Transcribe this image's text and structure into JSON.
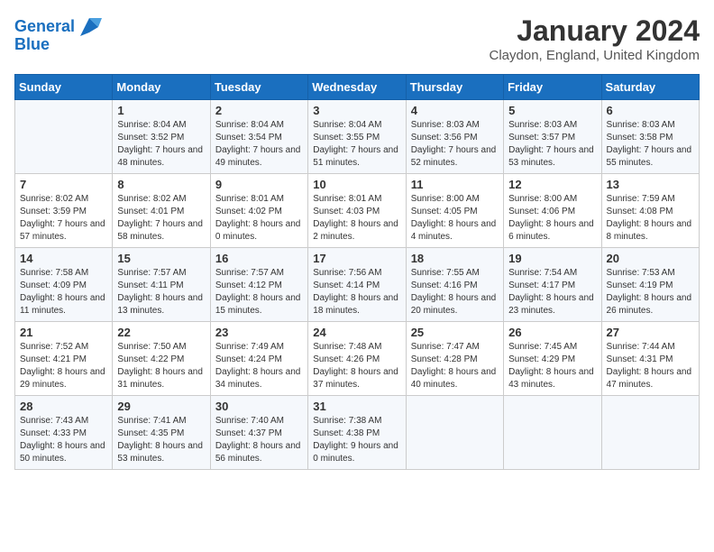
{
  "header": {
    "logo_line1": "General",
    "logo_line2": "Blue",
    "month": "January 2024",
    "location": "Claydon, England, United Kingdom"
  },
  "weekdays": [
    "Sunday",
    "Monday",
    "Tuesday",
    "Wednesday",
    "Thursday",
    "Friday",
    "Saturday"
  ],
  "weeks": [
    [
      {
        "day": "",
        "sunrise": "",
        "sunset": "",
        "daylight": ""
      },
      {
        "day": "1",
        "sunrise": "Sunrise: 8:04 AM",
        "sunset": "Sunset: 3:52 PM",
        "daylight": "Daylight: 7 hours and 48 minutes."
      },
      {
        "day": "2",
        "sunrise": "Sunrise: 8:04 AM",
        "sunset": "Sunset: 3:54 PM",
        "daylight": "Daylight: 7 hours and 49 minutes."
      },
      {
        "day": "3",
        "sunrise": "Sunrise: 8:04 AM",
        "sunset": "Sunset: 3:55 PM",
        "daylight": "Daylight: 7 hours and 51 minutes."
      },
      {
        "day": "4",
        "sunrise": "Sunrise: 8:03 AM",
        "sunset": "Sunset: 3:56 PM",
        "daylight": "Daylight: 7 hours and 52 minutes."
      },
      {
        "day": "5",
        "sunrise": "Sunrise: 8:03 AM",
        "sunset": "Sunset: 3:57 PM",
        "daylight": "Daylight: 7 hours and 53 minutes."
      },
      {
        "day": "6",
        "sunrise": "Sunrise: 8:03 AM",
        "sunset": "Sunset: 3:58 PM",
        "daylight": "Daylight: 7 hours and 55 minutes."
      }
    ],
    [
      {
        "day": "7",
        "sunrise": "Sunrise: 8:02 AM",
        "sunset": "Sunset: 3:59 PM",
        "daylight": "Daylight: 7 hours and 57 minutes."
      },
      {
        "day": "8",
        "sunrise": "Sunrise: 8:02 AM",
        "sunset": "Sunset: 4:01 PM",
        "daylight": "Daylight: 7 hours and 58 minutes."
      },
      {
        "day": "9",
        "sunrise": "Sunrise: 8:01 AM",
        "sunset": "Sunset: 4:02 PM",
        "daylight": "Daylight: 8 hours and 0 minutes."
      },
      {
        "day": "10",
        "sunrise": "Sunrise: 8:01 AM",
        "sunset": "Sunset: 4:03 PM",
        "daylight": "Daylight: 8 hours and 2 minutes."
      },
      {
        "day": "11",
        "sunrise": "Sunrise: 8:00 AM",
        "sunset": "Sunset: 4:05 PM",
        "daylight": "Daylight: 8 hours and 4 minutes."
      },
      {
        "day": "12",
        "sunrise": "Sunrise: 8:00 AM",
        "sunset": "Sunset: 4:06 PM",
        "daylight": "Daylight: 8 hours and 6 minutes."
      },
      {
        "day": "13",
        "sunrise": "Sunrise: 7:59 AM",
        "sunset": "Sunset: 4:08 PM",
        "daylight": "Daylight: 8 hours and 8 minutes."
      }
    ],
    [
      {
        "day": "14",
        "sunrise": "Sunrise: 7:58 AM",
        "sunset": "Sunset: 4:09 PM",
        "daylight": "Daylight: 8 hours and 11 minutes."
      },
      {
        "day": "15",
        "sunrise": "Sunrise: 7:57 AM",
        "sunset": "Sunset: 4:11 PM",
        "daylight": "Daylight: 8 hours and 13 minutes."
      },
      {
        "day": "16",
        "sunrise": "Sunrise: 7:57 AM",
        "sunset": "Sunset: 4:12 PM",
        "daylight": "Daylight: 8 hours and 15 minutes."
      },
      {
        "day": "17",
        "sunrise": "Sunrise: 7:56 AM",
        "sunset": "Sunset: 4:14 PM",
        "daylight": "Daylight: 8 hours and 18 minutes."
      },
      {
        "day": "18",
        "sunrise": "Sunrise: 7:55 AM",
        "sunset": "Sunset: 4:16 PM",
        "daylight": "Daylight: 8 hours and 20 minutes."
      },
      {
        "day": "19",
        "sunrise": "Sunrise: 7:54 AM",
        "sunset": "Sunset: 4:17 PM",
        "daylight": "Daylight: 8 hours and 23 minutes."
      },
      {
        "day": "20",
        "sunrise": "Sunrise: 7:53 AM",
        "sunset": "Sunset: 4:19 PM",
        "daylight": "Daylight: 8 hours and 26 minutes."
      }
    ],
    [
      {
        "day": "21",
        "sunrise": "Sunrise: 7:52 AM",
        "sunset": "Sunset: 4:21 PM",
        "daylight": "Daylight: 8 hours and 29 minutes."
      },
      {
        "day": "22",
        "sunrise": "Sunrise: 7:50 AM",
        "sunset": "Sunset: 4:22 PM",
        "daylight": "Daylight: 8 hours and 31 minutes."
      },
      {
        "day": "23",
        "sunrise": "Sunrise: 7:49 AM",
        "sunset": "Sunset: 4:24 PM",
        "daylight": "Daylight: 8 hours and 34 minutes."
      },
      {
        "day": "24",
        "sunrise": "Sunrise: 7:48 AM",
        "sunset": "Sunset: 4:26 PM",
        "daylight": "Daylight: 8 hours and 37 minutes."
      },
      {
        "day": "25",
        "sunrise": "Sunrise: 7:47 AM",
        "sunset": "Sunset: 4:28 PM",
        "daylight": "Daylight: 8 hours and 40 minutes."
      },
      {
        "day": "26",
        "sunrise": "Sunrise: 7:45 AM",
        "sunset": "Sunset: 4:29 PM",
        "daylight": "Daylight: 8 hours and 43 minutes."
      },
      {
        "day": "27",
        "sunrise": "Sunrise: 7:44 AM",
        "sunset": "Sunset: 4:31 PM",
        "daylight": "Daylight: 8 hours and 47 minutes."
      }
    ],
    [
      {
        "day": "28",
        "sunrise": "Sunrise: 7:43 AM",
        "sunset": "Sunset: 4:33 PM",
        "daylight": "Daylight: 8 hours and 50 minutes."
      },
      {
        "day": "29",
        "sunrise": "Sunrise: 7:41 AM",
        "sunset": "Sunset: 4:35 PM",
        "daylight": "Daylight: 8 hours and 53 minutes."
      },
      {
        "day": "30",
        "sunrise": "Sunrise: 7:40 AM",
        "sunset": "Sunset: 4:37 PM",
        "daylight": "Daylight: 8 hours and 56 minutes."
      },
      {
        "day": "31",
        "sunrise": "Sunrise: 7:38 AM",
        "sunset": "Sunset: 4:38 PM",
        "daylight": "Daylight: 9 hours and 0 minutes."
      },
      {
        "day": "",
        "sunrise": "",
        "sunset": "",
        "daylight": ""
      },
      {
        "day": "",
        "sunrise": "",
        "sunset": "",
        "daylight": ""
      },
      {
        "day": "",
        "sunrise": "",
        "sunset": "",
        "daylight": ""
      }
    ]
  ]
}
